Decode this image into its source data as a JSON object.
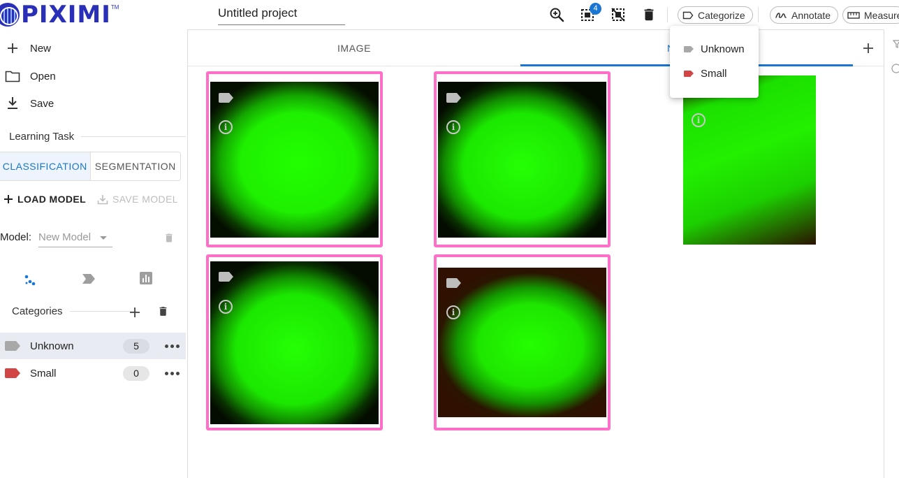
{
  "app": {
    "brand": "PIXIMI",
    "trademark": "TM"
  },
  "project": {
    "title": "Untitled project"
  },
  "toolbar": {
    "selection_badge": "4",
    "categorize_label": "Categorize",
    "annotate_label": "Annotate",
    "measure_label": "Measure"
  },
  "sidebar": {
    "file_items": [
      {
        "label": "New",
        "icon": "plus-icon"
      },
      {
        "label": "Open",
        "icon": "folder-icon"
      },
      {
        "label": "Save",
        "icon": "download-icon"
      }
    ],
    "learning_task": {
      "heading": "Learning Task",
      "options": [
        "CLASSIFICATION",
        "SEGMENTATION"
      ],
      "selected": "CLASSIFICATION"
    },
    "load_model_label": "LOAD MODEL",
    "save_model_label": "SAVE MODEL",
    "model": {
      "label": "Model:",
      "selected": "New Model"
    },
    "categories": {
      "heading": "Categories",
      "items": [
        {
          "name": "Unknown",
          "count": "5",
          "color": "#a8a8a8"
        },
        {
          "name": "Small",
          "count": "0",
          "color": "#d24545"
        }
      ]
    }
  },
  "main": {
    "tabs": [
      {
        "label": "IMAGE"
      },
      {
        "label": "N"
      }
    ]
  },
  "categorize_menu": {
    "items": [
      {
        "label": "Unknown",
        "color": "#a8a8a8"
      },
      {
        "label": "Small",
        "color": "#d24545"
      }
    ]
  },
  "colors": {
    "accent": "#1976d2",
    "selection_border": "#ff6ec7"
  }
}
